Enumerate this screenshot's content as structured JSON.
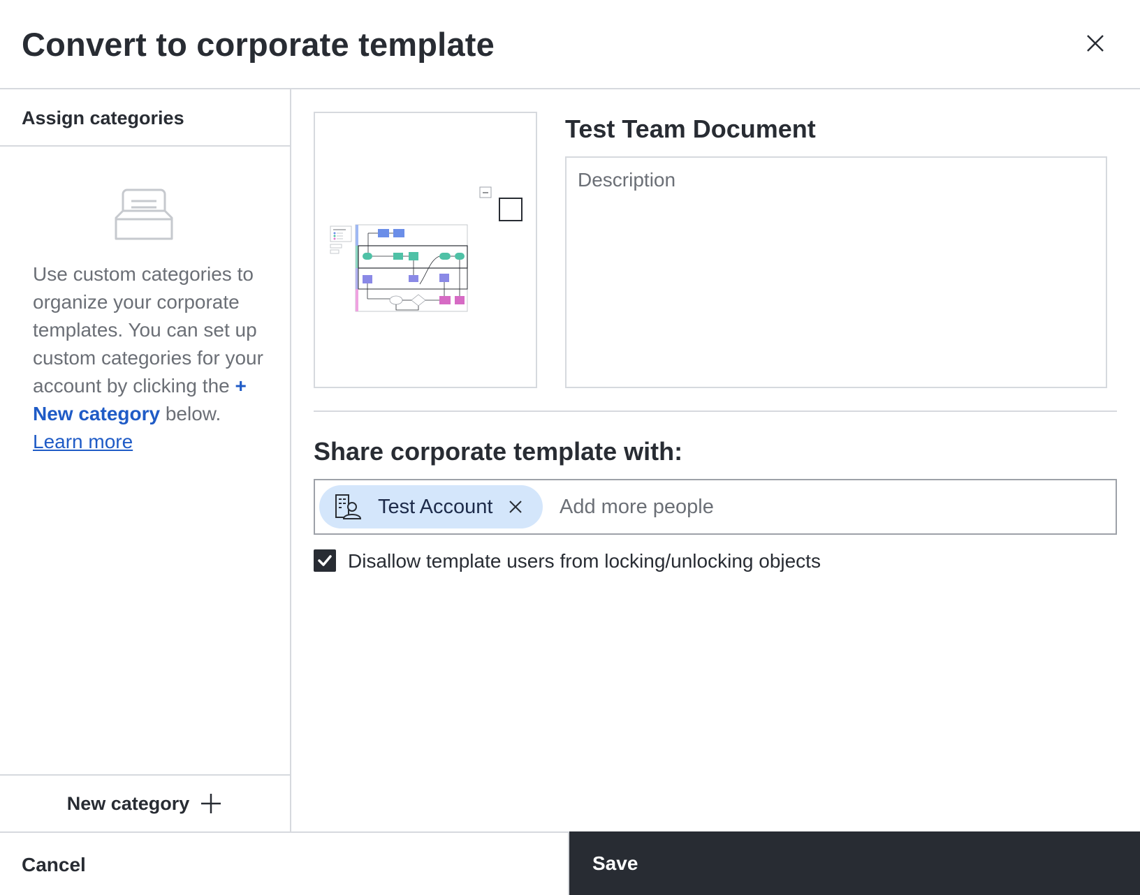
{
  "dialog": {
    "title": "Convert to corporate template"
  },
  "sidebar": {
    "heading": "Assign categories",
    "help_text_1": "Use custom categories to organize your corporate templates. You can set up custom categories for your account by clicking the ",
    "help_highlight": "+ New category",
    "help_text_2": " below.",
    "learn_more": "Learn more",
    "new_category_label": "New category"
  },
  "document": {
    "title": "Test Team Document",
    "description_placeholder": "Description",
    "description_value": ""
  },
  "share": {
    "heading": "Share corporate template with:",
    "chips": [
      {
        "label": "Test Account",
        "icon": "building-person-icon"
      }
    ],
    "input_placeholder": "Add more people"
  },
  "options": {
    "disallow_locking_label": "Disallow template users from locking/unlocking objects",
    "disallow_locking_checked": true
  },
  "footer": {
    "cancel_label": "Cancel",
    "save_label": "Save"
  },
  "colors": {
    "text_primary": "#282c33",
    "text_secondary": "#6b6f76",
    "link": "#1f5bc6",
    "chip_bg": "#d4e6fb",
    "save_bg": "#282c33",
    "border": "#d6d9de"
  }
}
